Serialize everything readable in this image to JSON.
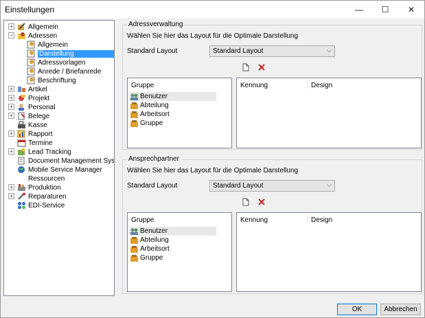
{
  "window": {
    "title": "Einstellungen",
    "minimize": "—",
    "maximize": "☐",
    "close": "✕"
  },
  "tree": {
    "items": [
      {
        "label": "Allgemein",
        "exp": "+",
        "icon": "wrench-icon"
      },
      {
        "label": "Adressen",
        "exp": "−",
        "icon": "address-folder-icon"
      },
      {
        "label": "Allgemein",
        "icon": "gear-icon"
      },
      {
        "label": "Darstellung",
        "icon": "gear-icon",
        "selected": true
      },
      {
        "label": "Adressvorlagen",
        "icon": "gear-icon"
      },
      {
        "label": "Anrede / Briefanrede",
        "icon": "gear-icon"
      },
      {
        "label": "Beschriftung",
        "icon": "gear-icon"
      },
      {
        "label": "Artikel",
        "exp": "+",
        "icon": "article-icon"
      },
      {
        "label": "Projekt",
        "exp": "+",
        "icon": "project-icon"
      },
      {
        "label": "Personal",
        "exp": "+",
        "icon": "personal-icon"
      },
      {
        "label": "Belege",
        "exp": "+",
        "icon": "document-icon"
      },
      {
        "label": "Kasse",
        "icon": "cash-register-icon"
      },
      {
        "label": "Rapport",
        "exp": "+",
        "icon": "report-icon"
      },
      {
        "label": "Termine",
        "icon": "calendar-icon"
      },
      {
        "label": "Lead Tracking",
        "exp": "+",
        "icon": "lead-tracking-icon"
      },
      {
        "label": "Document Management System",
        "icon": "dms-icon"
      },
      {
        "label": "Mobile Service Manager",
        "icon": "globe-icon"
      },
      {
        "label": "Ressourcen",
        "icon": "none"
      },
      {
        "label": "Produktion",
        "exp": "+",
        "icon": "production-icon"
      },
      {
        "label": "Reparaturen",
        "exp": "+",
        "icon": "repair-icon"
      },
      {
        "label": "EDI-Service",
        "icon": "edi-icon"
      }
    ]
  },
  "adress": {
    "title": "Adressverwaltung",
    "desc": "Wählen Sie hier das Layout für die Optimale Darstellung",
    "layout_label": "Standard Layout",
    "layout_value": "Standard Layout",
    "group_header": "Gruppe",
    "groups": [
      "Benutzer",
      "Abteilung",
      "Arbeitsort",
      "Gruppe"
    ],
    "col_kennung": "Kennung",
    "col_design": "Design"
  },
  "ansprech": {
    "title": "Ansprechpartner",
    "desc": "Wählen Sie hier das Layout für die Optimale Darstellung",
    "layout_label": "Standard Layout",
    "layout_value": "Standard Layout",
    "group_header": "Gruppe",
    "groups": [
      "Benutzer",
      "Abteilung",
      "Arbeitsort",
      "Gruppe"
    ],
    "col_kennung": "Kennung",
    "col_design": "Design"
  },
  "buttons": {
    "ok": "OK",
    "cancel": "Abbrechen"
  }
}
